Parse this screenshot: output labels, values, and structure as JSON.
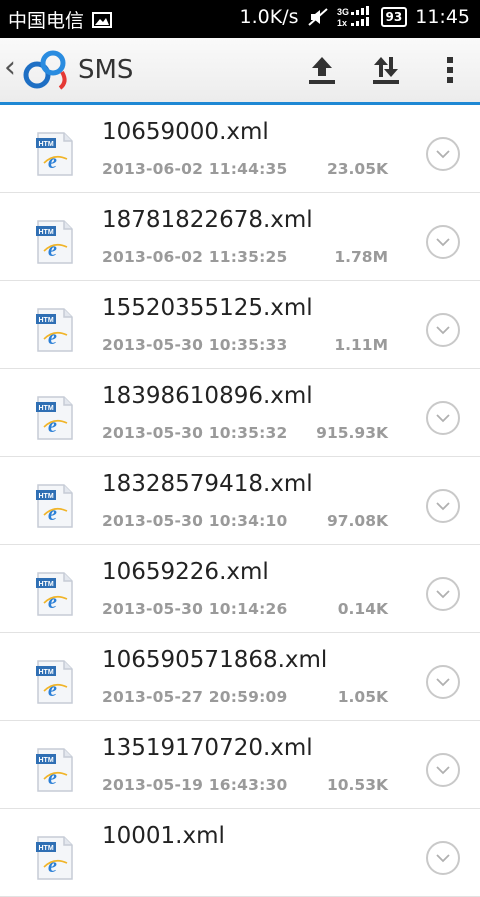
{
  "status_bar": {
    "carrier": "中国电信",
    "speed": "1.0K/s",
    "network": "3G",
    "network2": "1x",
    "battery": "93",
    "time": "11:45"
  },
  "action_bar": {
    "back_glyph": "‹",
    "title": "SMS"
  },
  "files": [
    {
      "name": "10659000.xml",
      "date": "2013-06-02  11:44:35",
      "size": "23.05K"
    },
    {
      "name": "18781822678.xml",
      "date": "2013-06-02  11:35:25",
      "size": "1.78M"
    },
    {
      "name": "15520355125.xml",
      "date": "2013-05-30  10:35:33",
      "size": "1.11M"
    },
    {
      "name": "18398610896.xml",
      "date": "2013-05-30  10:35:32",
      "size": "915.93K"
    },
    {
      "name": "18328579418.xml",
      "date": "2013-05-30  10:34:10",
      "size": "97.08K"
    },
    {
      "name": "10659226.xml",
      "date": "2013-05-30  10:14:26",
      "size": "0.14K"
    },
    {
      "name": "106590571868.xml",
      "date": "2013-05-27  20:59:09",
      "size": "1.05K"
    },
    {
      "name": "13519170720.xml",
      "date": "2013-05-19  16:43:30",
      "size": "10.53K"
    },
    {
      "name": "10001.xml",
      "date": "",
      "size": ""
    }
  ],
  "icons": {
    "file": "html-file-icon",
    "expand": "chevron-down-icon",
    "upload": "upload-icon",
    "transfer": "transfer-icon",
    "menu": "overflow-menu-icon"
  },
  "colors": {
    "accent": "#1e88d4",
    "status_bar": "#000000"
  }
}
